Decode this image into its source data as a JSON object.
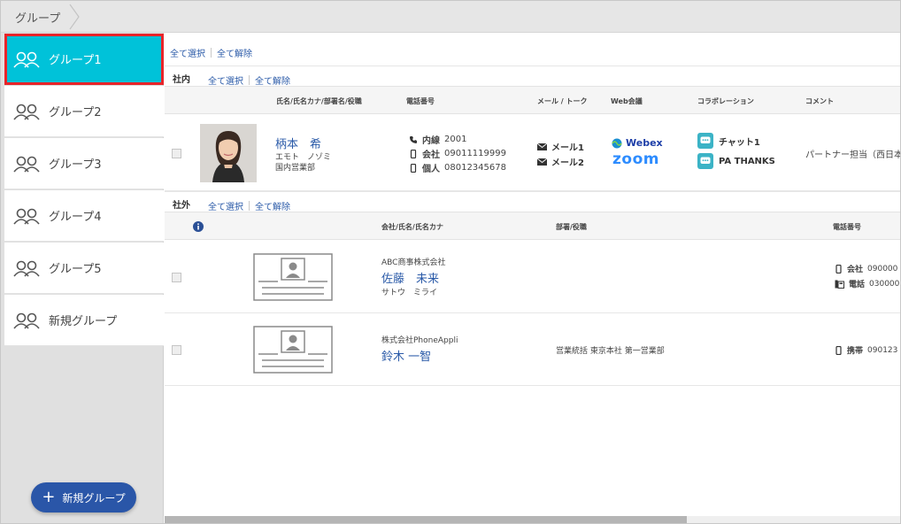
{
  "breadcrumb": {
    "label": "グループ"
  },
  "sidebar": {
    "groups": [
      {
        "label": "グループ1"
      },
      {
        "label": "グループ2"
      },
      {
        "label": "グループ3"
      },
      {
        "label": "グループ4"
      },
      {
        "label": "グループ5"
      },
      {
        "label": "新規グループ"
      }
    ],
    "new_group_button": "新規グループ"
  },
  "toolbar": {
    "select_all": "全て選択",
    "deselect_all": "全て解除"
  },
  "internal": {
    "title": "社内",
    "select_all": "全て選択",
    "deselect_all": "全て解除",
    "columns": {
      "name": "氏名/氏名カナ/部署名/役職",
      "phone": "電話番号",
      "mail": "メール / トーク",
      "web": "Web会議",
      "collab": "コラボレーション",
      "comment": "コメント"
    },
    "contact": {
      "name": "柄本　希",
      "kana": "エモト　ノゾミ",
      "dept": "国内営業部",
      "phones": [
        {
          "label": "内線",
          "number": "2001",
          "icon": "phone-icon"
        },
        {
          "label": "会社",
          "number": "09011119999",
          "icon": "mobile-icon"
        },
        {
          "label": "個人",
          "number": "08012345678",
          "icon": "mobile-icon"
        }
      ],
      "mails": [
        "メール1",
        "メール2"
      ],
      "web": {
        "webex": "Webex",
        "zoom": "zoom"
      },
      "collab": [
        "チャット1",
        "PA THANKS"
      ],
      "comment": "パートナー担当（西日本"
    }
  },
  "external": {
    "title": "社外",
    "select_all": "全て選択",
    "deselect_all": "全て解除",
    "columns": {
      "company": "会社/氏名/氏名カナ",
      "dept": "部署/役職",
      "phone": "電話番号"
    },
    "contacts": [
      {
        "company": "ABC商事株式会社",
        "name": "佐藤　未来",
        "kana": "サトウ　ミライ",
        "dept": "",
        "phones": [
          {
            "label": "会社",
            "number": "090000"
          },
          {
            "label": "電話",
            "number": "030000"
          }
        ]
      },
      {
        "company": "株式会社PhoneAppli",
        "name": "鈴木 一智",
        "kana": "",
        "dept": "営業統括 東京本社 第一営業部",
        "phones": [
          {
            "label": "携帯",
            "number": "090123"
          }
        ]
      }
    ]
  },
  "colors": {
    "active_group": "#00c2d9",
    "highlight_border": "#e8252a",
    "primary_button": "#2a56a8",
    "link": "#2a5aa8"
  }
}
